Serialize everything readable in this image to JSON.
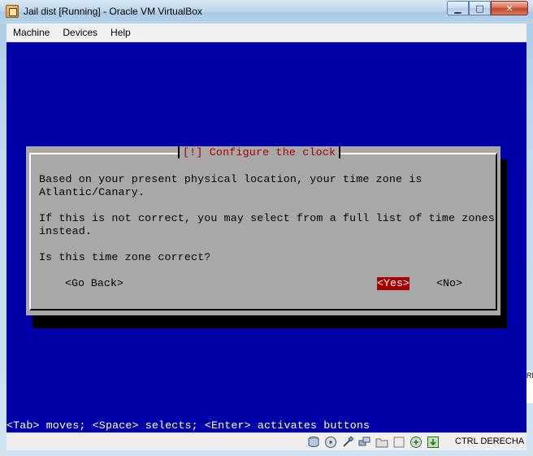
{
  "window": {
    "title": "Jail dist [Running] - Oracle VM VirtualBox",
    "minimize_glyph": "▁",
    "maximize_glyph": "□",
    "close_glyph": "✕"
  },
  "menubar": {
    "items": [
      "Machine",
      "Devices",
      "Help"
    ]
  },
  "dialog": {
    "title": "[!] Configure the clock",
    "lines": [
      "Based on your present physical location, your time zone is",
      "Atlantic/Canary.",
      "If this is not correct, you may select from a full list of time zones",
      "instead.",
      "Is this time zone correct?"
    ],
    "buttons": {
      "back": "<Go Back>",
      "yes": "<Yes>",
      "no": "<No>"
    }
  },
  "hint": "<Tab> moves; <Space> selects; <Enter> activates buttons",
  "edge_text": "RL",
  "statusbar": {
    "host_key": "CTRL DERECHA",
    "icons": [
      "hard-disk-icon",
      "optical-drive-icon",
      "usb-icon",
      "network-icon",
      "shared-folders-icon",
      "display-icon",
      "mouse-integration-icon",
      "host-key-icon"
    ]
  },
  "colors": {
    "screen_bg": "#0000a8",
    "dialog_bg": "#a8a8a8",
    "title_fg": "#a80000",
    "selected_button_bg": "#a80000"
  }
}
